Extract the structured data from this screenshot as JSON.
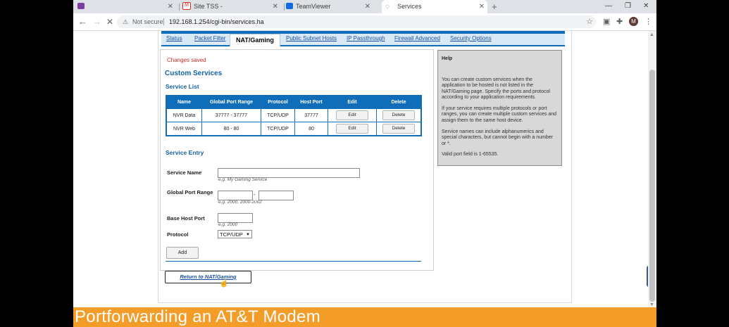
{
  "browser": {
    "tabs": [
      {
        "title": "",
        "favicon": "mail-icon"
      },
      {
        "title": "Site TSS -",
        "favicon": "gmail-icon"
      },
      {
        "title": "TeamViewer",
        "favicon": "teamviewer-icon"
      },
      {
        "title": "Services",
        "favicon": "globe-icon"
      }
    ],
    "address": {
      "security_label": "Not secure",
      "url": "192.168.1.254/cgi-bin/services.ha"
    },
    "avatar_initial": "M"
  },
  "subnav": {
    "items": [
      "Status",
      "Packet Filter",
      "NAT/Gaming",
      "Public Subnet Hosts",
      "IP Passthrough",
      "Firewall Advanced",
      "Security Options"
    ],
    "active": "NAT/Gaming"
  },
  "page": {
    "status_message": "Changes saved",
    "heading": "Custom Services",
    "service_list_heading": "Service List",
    "table": {
      "headers": [
        "Name",
        "Global Port Range",
        "Protocol",
        "Host Port",
        "Edit",
        "Delete"
      ],
      "rows": [
        {
          "name": "NVR Data",
          "range": "37777 - 37777",
          "protocol": "TCP/UDP",
          "host_port": "37777",
          "edit": "Edit",
          "delete": "Delete"
        },
        {
          "name": "NVR Web",
          "range": "80 - 80",
          "protocol": "TCP/UDP",
          "host_port": "80",
          "edit": "Edit",
          "delete": "Delete"
        }
      ]
    },
    "service_entry_heading": "Service Entry",
    "form": {
      "service_name_label": "Service Name",
      "service_name_value": "",
      "service_name_hint": "e.g. My Gaming Service",
      "port_range_label": "Global Port Range",
      "port_range_sep": "-",
      "port_range_hint": "e.g. 2000, 2000-2002",
      "host_port_label": "Base Host Port",
      "host_port_hint": "e.g. 2000",
      "protocol_label": "Protocol",
      "protocol_value": "TCP/UDP",
      "add_label": "Add"
    },
    "return_label": "Return to NAT/Gaming"
  },
  "help": {
    "title": "Help",
    "paragraphs": [
      "You can create custom services when the application to be hosted is not listed in the NAT/Gaming page. Specify the ports and protocol according to your application requirements.",
      "If your service requires multiple protocols or port ranges, you can create multiple custom services and assign them to the same host device.",
      "Service names can include alphanumerics and special characters, but cannot begin with a number or *.",
      "Valid port field is 1-65535."
    ]
  },
  "banner_text": "Portforwarding an AT&T Modem",
  "colors": {
    "accent": "#0f6dba",
    "banner": "#f39c28",
    "status_red": "#c0302b"
  }
}
